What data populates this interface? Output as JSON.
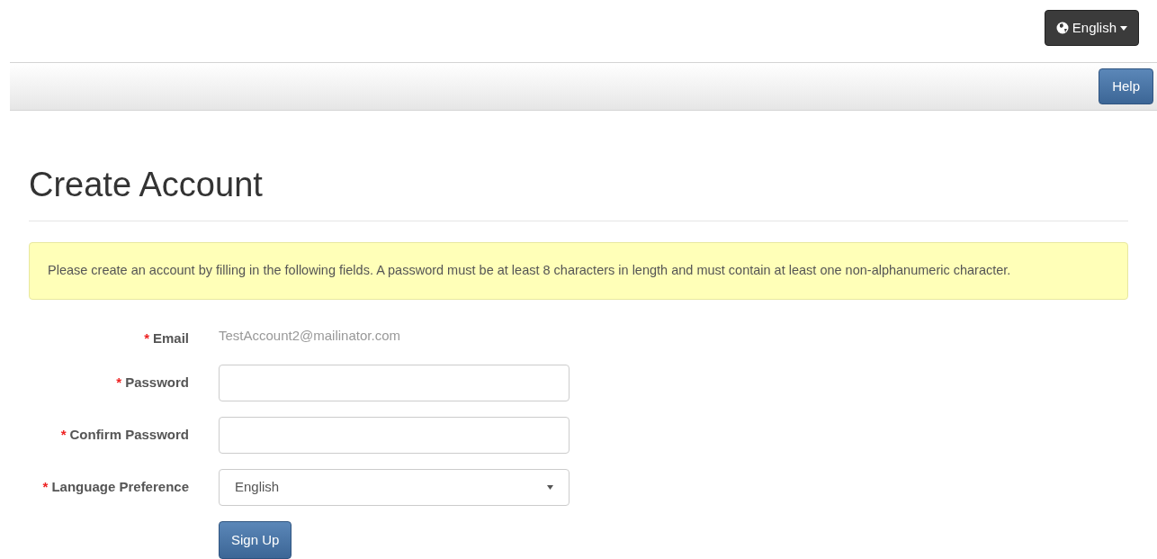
{
  "language_button": {
    "label": "English"
  },
  "navbar": {
    "help_button": "Help"
  },
  "heading": "Create Account",
  "alert": "Please create an account by filling in the following fields. A password must be at least 8 characters in length and must contain at least one non-alphanumeric character.",
  "form": {
    "fields": [
      {
        "kind": "static",
        "required_mark": "*",
        "label": "Email",
        "value": "TestAccount2@mailinator.com"
      },
      {
        "kind": "input",
        "required_mark": "*",
        "label": "Password"
      },
      {
        "kind": "input",
        "required_mark": "*",
        "label": "Confirm Password"
      },
      {
        "kind": "select",
        "required_mark": "*",
        "label": "Language Preference",
        "value": "English"
      }
    ],
    "submit": "Sign Up"
  }
}
